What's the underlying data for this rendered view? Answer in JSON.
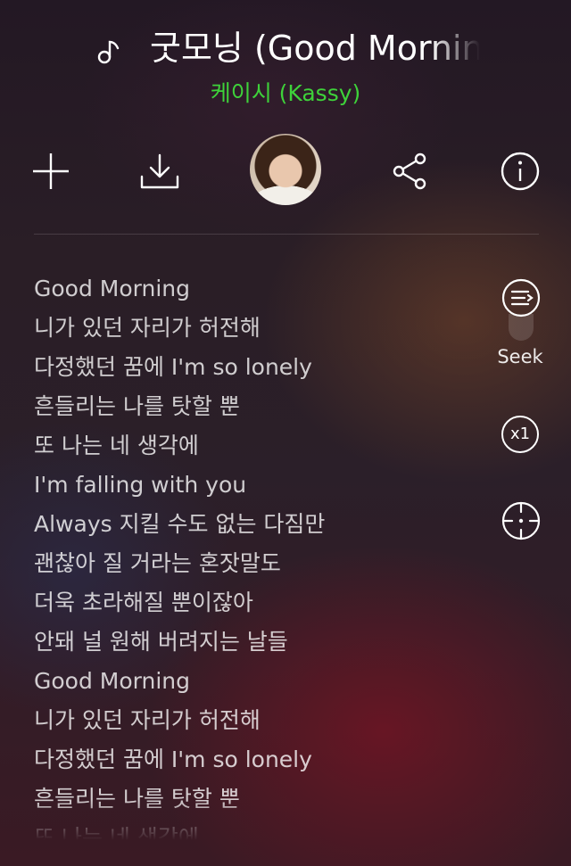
{
  "header": {
    "song_title": "굿모닝 (Good Morning)",
    "artist": "케이시 (Kassy)",
    "note_icon": "music-note-icon"
  },
  "actions": [
    {
      "name": "add-button",
      "icon": "plus-icon"
    },
    {
      "name": "download-button",
      "icon": "download-icon"
    },
    {
      "name": "album-art-avatar",
      "icon": "artist-photo"
    },
    {
      "name": "share-button",
      "icon": "share-icon"
    },
    {
      "name": "info-button",
      "icon": "info-icon"
    }
  ],
  "lyrics": [
    "Good Morning",
    "니가 있던 자리가 허전해",
    "다정했던 꿈에 I'm so lonely",
    "흔들리는 나를 탓할 뿐",
    "또 나는 네 생각에",
    "I'm falling with you",
    "Always 지킬 수도 없는 다짐만",
    "괜찮아 질 거라는 혼잣말도",
    "더욱 초라해질 뿐이잖아",
    "안돼 널 원해 버려지는 날들",
    "Good Morning",
    "니가 있던 자리가 허전해",
    "다정했던 꿈에 I'm so lonely",
    "흔들리는 나를 탓할 뿐",
    "또 나는 네 생각에"
  ],
  "side_controls": {
    "seek_label": "Seek",
    "speed_label": "x1"
  },
  "colors": {
    "artist_green": "#3ed23a",
    "text": "#ffffff"
  }
}
